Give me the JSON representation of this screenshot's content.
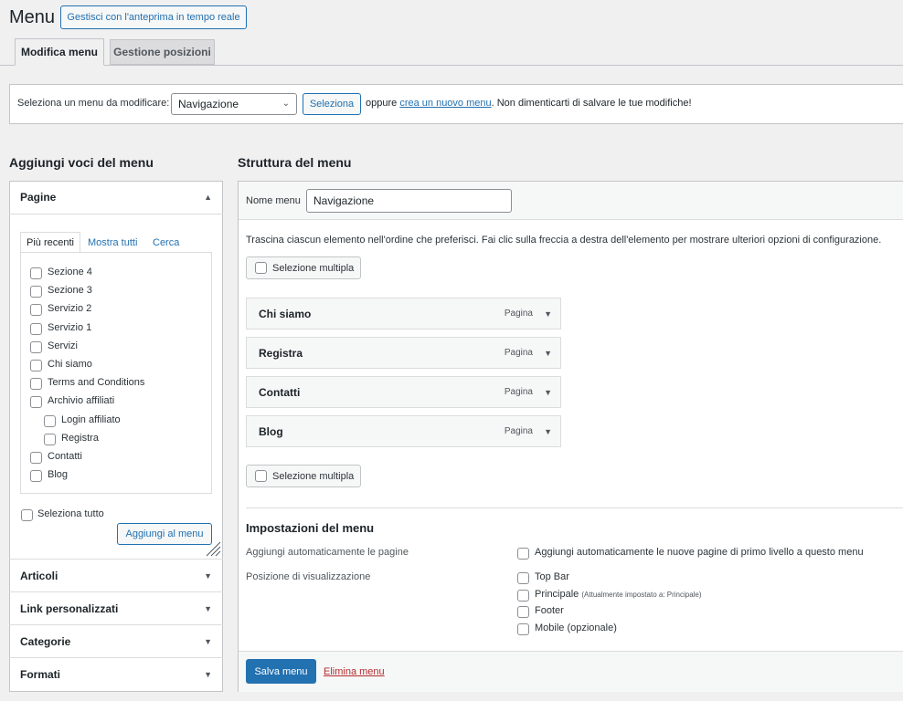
{
  "header": {
    "title": "Menu",
    "preview_button": "Gestisci con l'anteprima in tempo reale"
  },
  "tabs": [
    {
      "label": "Modifica menu",
      "active": true
    },
    {
      "label": "Gestione posizioni",
      "active": false
    }
  ],
  "select_bar": {
    "label": "Seleziona un menu da modificare:",
    "selected": "Navigazione",
    "button": "Seleziona",
    "or_text": "oppure",
    "create_link": "crea un nuovo menu",
    "tail_text": ". Non dimenticarti di salvare le tue modifiche!"
  },
  "left": {
    "heading": "Aggiungi voci del menu",
    "pages": {
      "title": "Pagine",
      "subtabs": [
        "Più recenti",
        "Mostra tutti",
        "Cerca"
      ],
      "items": [
        {
          "label": "Sezione 4",
          "indent": 0
        },
        {
          "label": "Sezione 3",
          "indent": 0
        },
        {
          "label": "Servizio 2",
          "indent": 0
        },
        {
          "label": "Servizio 1",
          "indent": 0
        },
        {
          "label": "Servizi",
          "indent": 0
        },
        {
          "label": "Chi siamo",
          "indent": 0
        },
        {
          "label": "Terms and Conditions",
          "indent": 0
        },
        {
          "label": "Archivio affiliati",
          "indent": 0
        },
        {
          "label": "Login affiliato",
          "indent": 1
        },
        {
          "label": "Registra",
          "indent": 1
        },
        {
          "label": "Contatti",
          "indent": 0
        },
        {
          "label": "Blog",
          "indent": 0
        }
      ],
      "select_all": "Seleziona tutto",
      "add_button": "Aggiungi al menu"
    },
    "sections": [
      "Articoli",
      "Link personalizzati",
      "Categorie",
      "Formati"
    ]
  },
  "right": {
    "heading": "Struttura del menu",
    "name_label": "Nome menu",
    "name_value": "Navigazione",
    "instructions": "Trascina ciascun elemento nell'ordine che preferisci. Fai clic sulla freccia a destra dell'elemento per mostrare ulteriori opzioni di configurazione.",
    "bulk_select": "Selezione multipla",
    "menu_items": [
      {
        "label": "Chi siamo",
        "type": "Pagina"
      },
      {
        "label": "Registra",
        "type": "Pagina"
      },
      {
        "label": "Contatti",
        "type": "Pagina"
      },
      {
        "label": "Blog",
        "type": "Pagina"
      }
    ],
    "settings": {
      "heading": "Impostazioni del menu",
      "auto_add_label": "Aggiungi automaticamente le pagine",
      "auto_add_option": "Aggiungi automaticamente le nuove pagine di primo livello a questo menu",
      "position_label": "Posizione di visualizzazione",
      "positions": [
        {
          "label": "Top Bar",
          "note": ""
        },
        {
          "label": "Principale",
          "note": "(Attualmente impostato a: Principale)"
        },
        {
          "label": "Footer",
          "note": ""
        },
        {
          "label": "Mobile (opzionale)",
          "note": ""
        }
      ]
    },
    "save_button": "Salva menu",
    "delete_link": "Elimina menu"
  },
  "colors": {
    "accent": "#2271b1",
    "danger": "#b32d2e",
    "background": "#f0f0f1"
  }
}
